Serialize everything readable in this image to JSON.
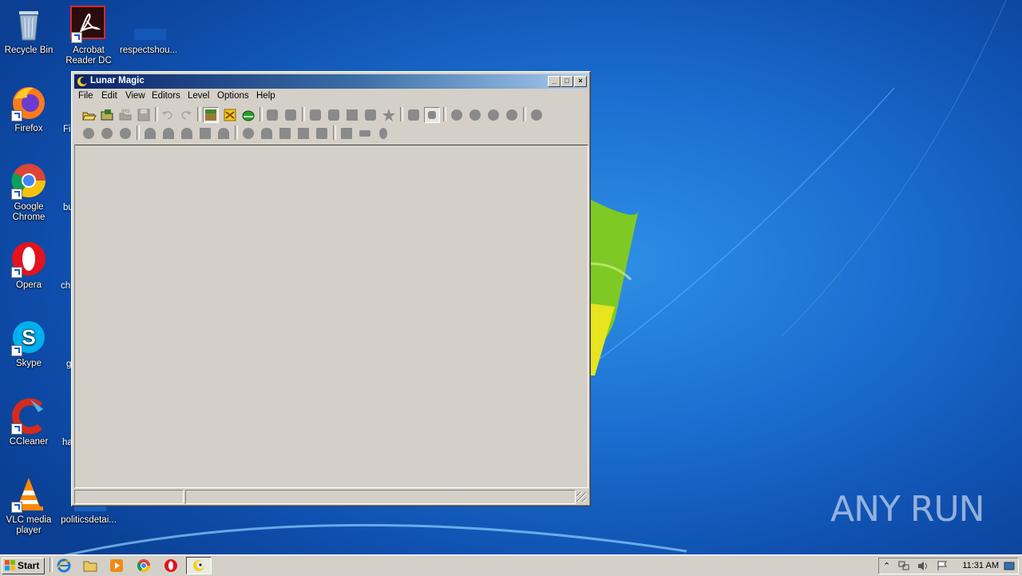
{
  "desktop": {
    "icons": [
      {
        "label": "Recycle Bin",
        "icon": "recycle-bin-icon"
      },
      {
        "label": "Acrobat Reader DC",
        "icon": "acrobat-icon"
      },
      {
        "label": "respectshou...",
        "icon": "file-icon"
      },
      {
        "label": "Firefox",
        "icon": "firefox-icon"
      },
      {
        "label": "Google Chrome",
        "icon": "chrome-icon"
      },
      {
        "label": "Opera",
        "icon": "opera-icon"
      },
      {
        "label": "Skype",
        "icon": "skype-icon"
      },
      {
        "label": "CCleaner",
        "icon": "ccleaner-icon"
      },
      {
        "label": "VLC media player",
        "icon": "vlc-icon"
      },
      {
        "label": "politicsdetai...",
        "icon": "file-icon"
      }
    ],
    "partial_labels": [
      "Fi",
      "bu",
      "ch",
      "g",
      "ha"
    ],
    "watermark": "ANY RUN"
  },
  "window": {
    "title": "Lunar Magic",
    "controls": {
      "minimize": "_",
      "maximize": "□",
      "close": "×"
    },
    "menu": [
      "File",
      "Edit",
      "View",
      "Editors",
      "Level",
      "Options",
      "Help"
    ]
  },
  "taskbar": {
    "start_label": "Start",
    "clock": "11:31 AM",
    "quicklaunch": [
      "internet-explorer-icon",
      "folder-icon",
      "media-player-icon",
      "chrome-icon",
      "opera-icon"
    ],
    "tasks": [
      "lunar-magic-icon"
    ]
  },
  "colors": {
    "title_start": "#0a246a",
    "title_end": "#a6caf0",
    "face": "#d4d0c8"
  }
}
